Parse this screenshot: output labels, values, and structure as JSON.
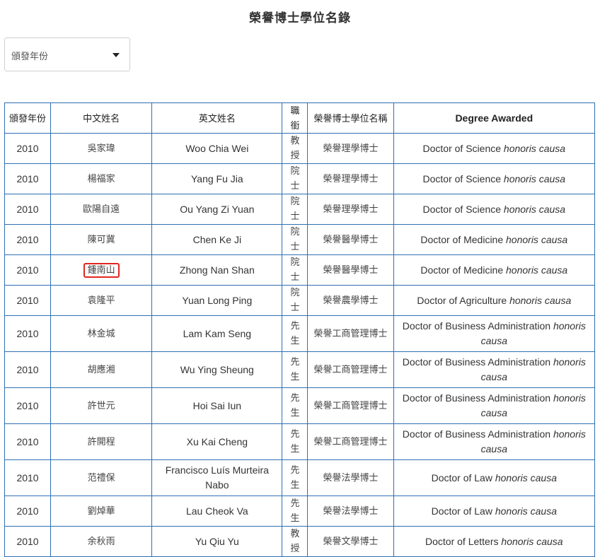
{
  "page": {
    "title": "榮譽博士學位名錄"
  },
  "filter": {
    "year_label": "頒發年份",
    "highlight_color": "#e0271f",
    "border_color": "#2f6fb3"
  },
  "table": {
    "headers": [
      "頒發年份",
      "中文姓名",
      "英文姓名",
      "職銜",
      "榮譽博士學位名稱",
      "Degree Awarded"
    ],
    "rows": [
      {
        "year": "2010",
        "cn_name": "吳家瑋",
        "en_name": "Woo Chia Wei",
        "title": "教授",
        "degree_cn": "榮譽理學博士",
        "degree_en": "Doctor of Science",
        "honoris": "honoris causa",
        "highlighted": false
      },
      {
        "year": "2010",
        "cn_name": "楊福家",
        "en_name": "Yang Fu Jia",
        "title": "院士",
        "degree_cn": "榮譽理學博士",
        "degree_en": "Doctor of Science",
        "honoris": "honoris causa",
        "highlighted": false
      },
      {
        "year": "2010",
        "cn_name": "歐陽自遠",
        "en_name": "Ou Yang Zi Yuan",
        "title": "院士",
        "degree_cn": "榮譽理學博士",
        "degree_en": "Doctor of Science",
        "honoris": "honoris causa",
        "highlighted": false
      },
      {
        "year": "2010",
        "cn_name": "陳可冀",
        "en_name": "Chen Ke Ji",
        "title": "院士",
        "degree_cn": "榮譽醫學博士",
        "degree_en": "Doctor of Medicine",
        "honoris": "honoris causa",
        "highlighted": false
      },
      {
        "year": "2010",
        "cn_name": "鍾南山",
        "en_name": "Zhong Nan Shan",
        "title": "院士",
        "degree_cn": "榮譽醫學博士",
        "degree_en": "Doctor of Medicine",
        "honoris": "honoris causa",
        "highlighted": true
      },
      {
        "year": "2010",
        "cn_name": "袁隆平",
        "en_name": "Yuan Long Ping",
        "title": "院士",
        "degree_cn": "榮譽農學博士",
        "degree_en": "Doctor of Agriculture",
        "honoris": "honoris causa",
        "highlighted": false
      },
      {
        "year": "2010",
        "cn_name": "林金城",
        "en_name": "Lam Kam Seng",
        "title": "先生",
        "degree_cn": "榮譽工商管理博士",
        "degree_en": "Doctor of Business Administration",
        "honoris": "honoris causa",
        "highlighted": false
      },
      {
        "year": "2010",
        "cn_name": "胡應湘",
        "en_name": "Wu Ying Sheung",
        "title": "先生",
        "degree_cn": "榮譽工商管理博士",
        "degree_en": "Doctor of Business Administration",
        "honoris": "honoris causa",
        "highlighted": false
      },
      {
        "year": "2010",
        "cn_name": "許世元",
        "en_name": "Hoi Sai Iun",
        "title": "先生",
        "degree_cn": "榮譽工商管理博士",
        "degree_en": "Doctor of Business Administration",
        "honoris": "honoris causa",
        "highlighted": false
      },
      {
        "year": "2010",
        "cn_name": "許開程",
        "en_name": "Xu Kai Cheng",
        "title": "先生",
        "degree_cn": "榮譽工商管理博士",
        "degree_en": "Doctor of Business Administration",
        "honoris": "honoris causa",
        "highlighted": false
      },
      {
        "year": "2010",
        "cn_name": "范禮保",
        "en_name": "Francisco Luís Murteira Nabo",
        "title": "先生",
        "degree_cn": "榮譽法學博士",
        "degree_en": "Doctor of Law",
        "honoris": "honoris causa",
        "highlighted": false
      },
      {
        "year": "2010",
        "cn_name": "劉焯華",
        "en_name": "Lau Cheok Va",
        "title": "先生",
        "degree_cn": "榮譽法學博士",
        "degree_en": "Doctor of Law",
        "honoris": "honoris causa",
        "highlighted": false
      },
      {
        "year": "2010",
        "cn_name": "余秋雨",
        "en_name": "Yu Qiu Yu",
        "title": "教授",
        "degree_cn": "榮譽文學博士",
        "degree_en": "Doctor of Letters",
        "honoris": "honoris causa",
        "highlighted": false
      }
    ]
  }
}
